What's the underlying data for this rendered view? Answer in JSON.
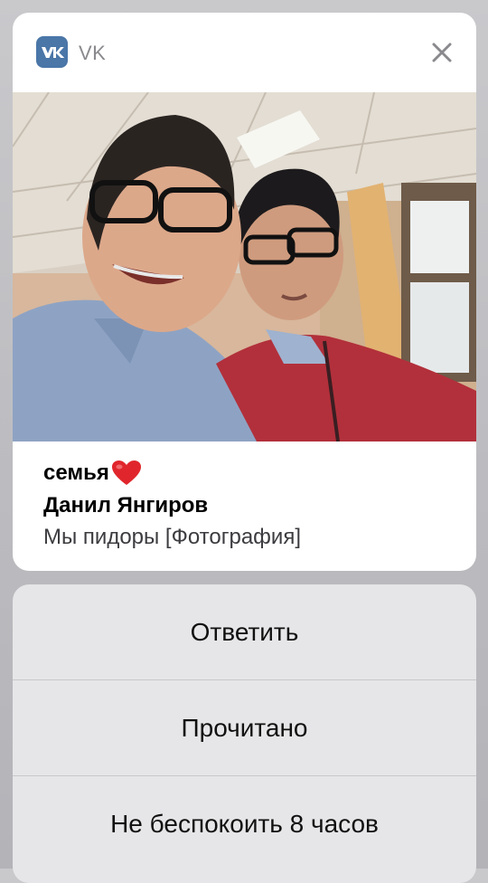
{
  "notification": {
    "app_name": "VK",
    "icon": "vk-logo-icon",
    "accent_color": "#4a76a8",
    "chat_title": "семья",
    "chat_emoji": "heart-emoji-icon",
    "sender": "Данил Янгиров",
    "message": "Мы пидоры [Фотография]"
  },
  "actions": [
    {
      "label": "Ответить"
    },
    {
      "label": "Прочитано"
    },
    {
      "label": "Не беспокоить 8 часов"
    }
  ]
}
